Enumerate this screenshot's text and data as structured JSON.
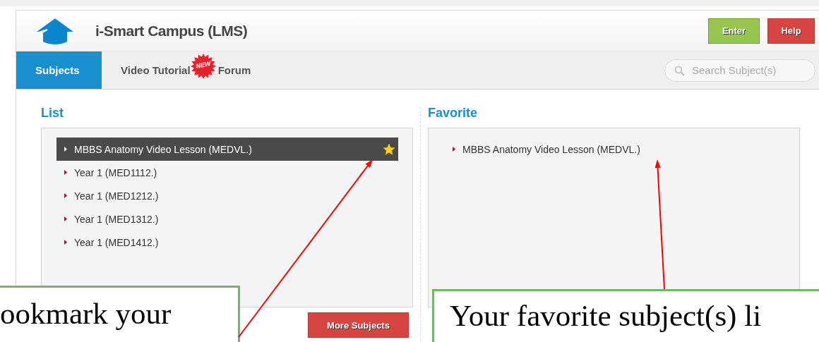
{
  "app": {
    "title": "i-Smart Campus (LMS)",
    "buttons": [
      {
        "label": "Enter",
        "kind": "enter"
      },
      {
        "label": "Help",
        "kind": "help"
      }
    ]
  },
  "tabs": [
    {
      "label": "Subjects",
      "selected": true
    },
    {
      "label": "Video Tutorial",
      "selected": false,
      "badge": "NEW"
    },
    {
      "label": "Forum",
      "selected": false
    }
  ],
  "search": {
    "placeholder": "Search Subject(s)"
  },
  "list": {
    "heading": "List",
    "items": [
      {
        "label": "MBBS Anatomy Video Lesson (MEDVL.)",
        "selected": true,
        "favorite": true
      },
      {
        "label": "Year 1 (MED1112.)",
        "selected": false,
        "favorite": false
      },
      {
        "label": "Year 1 (MED1212.)",
        "selected": false,
        "favorite": false
      },
      {
        "label": "Year 1 (MED1312.)",
        "selected": false,
        "favorite": false
      },
      {
        "label": "Year 1 (MED1412.)",
        "selected": false,
        "favorite": false
      }
    ],
    "more_button": "More Subjects"
  },
  "favorite": {
    "heading": "Favorite",
    "items": [
      {
        "label": "MBBS Anatomy Video Lesson (MEDVL.)"
      }
    ]
  },
  "callouts": [
    {
      "text": "ookmark your"
    },
    {
      "text": "Your favorite subject(s) li"
    }
  ]
}
